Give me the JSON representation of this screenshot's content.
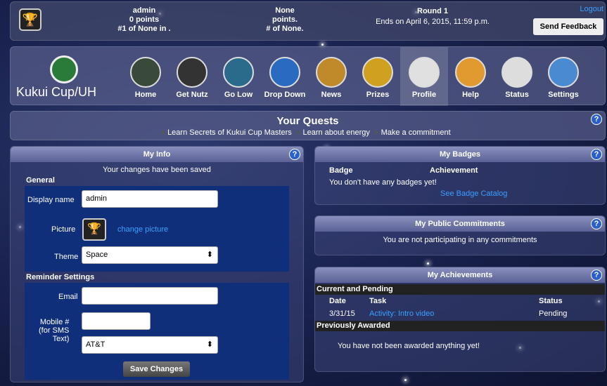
{
  "top": {
    "user": "admin",
    "points": "0 points",
    "rank": "#1 of None in .",
    "team": "None",
    "team_points": "points.",
    "team_rank": "# of None.",
    "round": "Round 1",
    "round_end": "Ends on April 6, 2015, 11:59 p.m.",
    "logout": "Logout",
    "feedback": "Send Feedback"
  },
  "brand": "Kukui Cup/UH",
  "nav": [
    {
      "label": "Home",
      "icon": "trophy-icon"
    },
    {
      "label": "Get Nutz",
      "icon": "counter-icon"
    },
    {
      "label": "Go Low",
      "icon": "gauge-icon"
    },
    {
      "label": "Drop Down",
      "icon": "water-drop-icon"
    },
    {
      "label": "News",
      "icon": "megaphone-icon"
    },
    {
      "label": "Prizes",
      "icon": "medal-icon"
    },
    {
      "label": "Profile",
      "icon": "profile-icon"
    },
    {
      "label": "Help",
      "icon": "question-icon"
    },
    {
      "label": "Status",
      "icon": "chart-icon"
    },
    {
      "label": "Settings",
      "icon": "wrench-icon"
    }
  ],
  "quests": {
    "title": "Your Quests",
    "items": [
      "Learn Secrets of Kukui Cup Masters",
      "Learn about energy",
      "Make a commitment"
    ]
  },
  "myinfo": {
    "title": "My Info",
    "saved": "Your changes have been saved",
    "general": "General",
    "display_label": "Display name",
    "display_value": "admin",
    "picture_label": "Picture",
    "change_picture": "change picture",
    "theme_label": "Theme",
    "theme_value": "Space",
    "reminder": "Reminder Settings",
    "email_label": "Email",
    "mobile_label_1": "Mobile #",
    "mobile_label_2": "(for SMS",
    "mobile_label_3": "Text)",
    "carrier_value": "AT&T",
    "save": "Save Changes"
  },
  "badges": {
    "title": "My Badges",
    "col1": "Badge",
    "col2": "Achievement",
    "empty": "You don't have any badges yet!",
    "catalog": "See Badge Catalog"
  },
  "commitments": {
    "title": "My Public Commitments",
    "empty": "You are not participating in any commitments"
  },
  "achievements": {
    "title": "My Achievements",
    "current": "Current and Pending",
    "h_date": "Date",
    "h_task": "Task",
    "h_status": "Status",
    "row_date": "3/31/15",
    "row_task": "Activity: Intro video",
    "row_status": "Pending",
    "previous": "Previously Awarded",
    "none": "You have not been awarded anything yet!"
  },
  "help_glyph": "?"
}
